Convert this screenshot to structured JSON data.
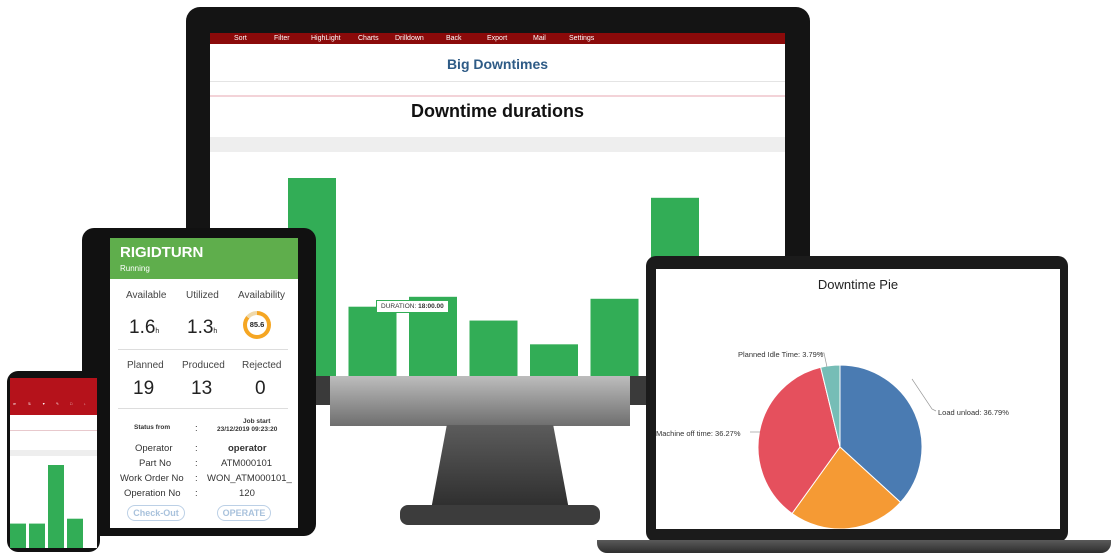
{
  "monitor": {
    "menu": [
      "Sort",
      "Filter",
      "HighLight",
      "Charts",
      "Drilldown",
      "Back",
      "Export",
      "Mail",
      "Settings"
    ],
    "report_title": "Big Downtimes",
    "chart_title": "Downtime durations",
    "tooltip_label": "DURATION:",
    "tooltip_value": "18:00.00"
  },
  "tablet": {
    "machine_name": "RIGIDTURN",
    "machine_status": "Running",
    "available_label": "Available",
    "available_value": "1.6",
    "utilized_label": "Utilized",
    "utilized_value": "1.3",
    "hour_unit": "h",
    "availability_label": "Availability",
    "availability_value": "85.6",
    "planned_label": "Planned",
    "planned_value": "19",
    "produced_label": "Produced",
    "produced_value": "13",
    "rejected_label": "Rejected",
    "rejected_value": "0",
    "status_from_label": "Status from",
    "colon": ":",
    "job_start_label": "Job start",
    "job_start_value": "23/12/2019 09:23:20",
    "operator_label": "Operator",
    "operator_value": "operator",
    "part_no_label": "Part No",
    "part_no_value": "ATM000101",
    "work_order_label": "Work Order No",
    "work_order_value": "WON_ATM000101_",
    "operation_label": "Operation No",
    "operation_value": "120",
    "checkout_label": "Check-Out",
    "operate_label": "OPERATE"
  },
  "laptop": {
    "pie_title": "Downtime Pie",
    "labels": {
      "load_unload": "Load unload: 36.79%",
      "machine_off": "Machine off time: 36.27%",
      "planned_idle": "Planned Idle Time: 3.79%"
    }
  },
  "chart_data": [
    {
      "type": "bar",
      "title": "Downtime durations",
      "values": [
        100,
        35,
        40,
        28,
        16,
        39,
        90
      ],
      "colors": {
        "bar": "#32ad56"
      }
    },
    {
      "type": "pie",
      "title": "Downtime Pie",
      "slices": [
        {
          "name": "Load unload",
          "value": 36.79,
          "color": "#4a7bb2"
        },
        {
          "name": "",
          "value": 23.15,
          "color": "#f59a34"
        },
        {
          "name": "Machine off time",
          "value": 36.27,
          "color": "#e5505d"
        },
        {
          "name": "Planned Idle Time",
          "value": 3.79,
          "color": "#76bdb6"
        }
      ]
    },
    {
      "type": "bar",
      "title": "",
      "values": [
        25,
        25,
        85,
        30
      ],
      "colors": {
        "bar": "#32ad56"
      }
    }
  ]
}
